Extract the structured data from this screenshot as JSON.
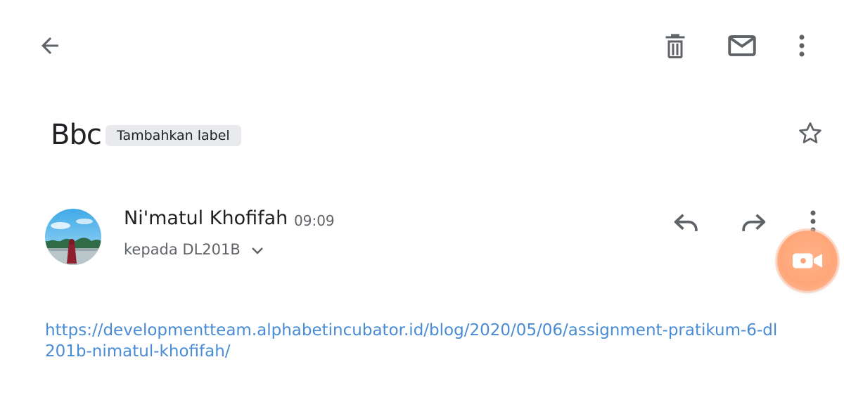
{
  "toolbar": {
    "back_icon": "arrow-back-icon",
    "delete_icon": "trash-icon",
    "mark_unread_icon": "mail-icon",
    "more_icon": "more-vert-icon"
  },
  "email": {
    "subject": "Bbc",
    "label_chip": "Tambahkan label",
    "star_icon": "star-outline-icon"
  },
  "message": {
    "sender_name": "Ni'matul Khofifah",
    "time": "09:09",
    "recipient": "kepada DL201B",
    "reply_icon": "reply-icon",
    "forward_icon": "forward-icon",
    "more_icon": "more-vert-icon",
    "body_link": "https://developmentteam.alphabetincubator.id/blog/2020/05/06/assignment-pratikum-6-dl201b-nimatul-khofifah/"
  },
  "fab": {
    "icon": "video-camera-icon",
    "color": "#ffa679"
  },
  "colors": {
    "link": "#4a8bd6",
    "icon": "#5f6368",
    "text": "#202124",
    "chip_bg": "#e8eaed"
  }
}
